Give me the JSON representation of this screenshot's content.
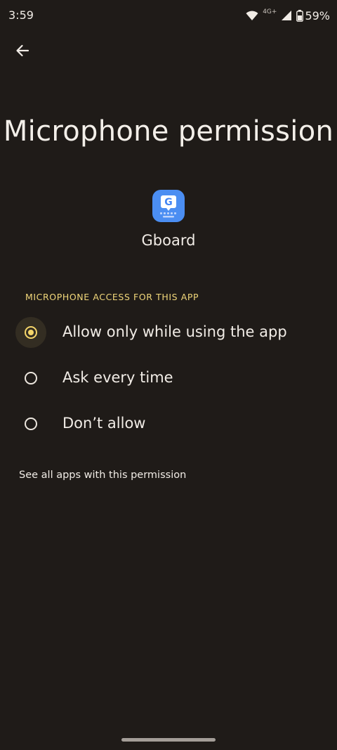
{
  "status_bar": {
    "time": "3:59",
    "network_label": "4G+",
    "battery": "59%"
  },
  "header": {
    "title": "Microphone permission"
  },
  "app": {
    "name": "Gboard",
    "icon_letter": "G"
  },
  "section": {
    "label": "MICROPHONE ACCESS FOR THIS APP"
  },
  "options": [
    {
      "label": "Allow only while using the app",
      "selected": true
    },
    {
      "label": "Ask every time",
      "selected": false
    },
    {
      "label": "Don’t allow",
      "selected": false
    }
  ],
  "link": {
    "label": "See all apps with this permission"
  },
  "colors": {
    "background": "#1f1b18",
    "accent": "#f4d56a",
    "section_header": "#f1d77a",
    "app_icon": "#4b8ef2"
  }
}
